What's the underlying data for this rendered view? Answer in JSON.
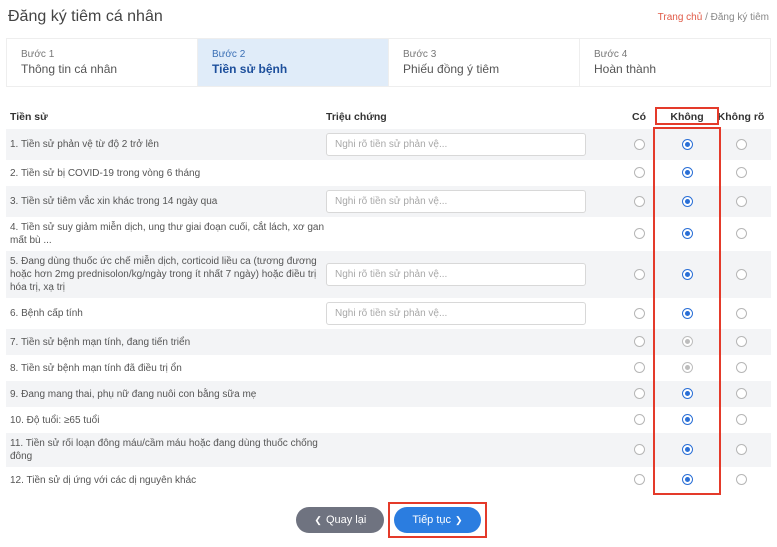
{
  "header": {
    "title": "Đăng ký tiêm cá nhân",
    "breadcrumb_home": "Trang chủ",
    "breadcrumb_sep": "/",
    "breadcrumb_current": "Đăng ký tiêm"
  },
  "steps": [
    {
      "num": "Bước 1",
      "label": "Thông tin cá nhân"
    },
    {
      "num": "Bước 2",
      "label": "Tiền sử bệnh"
    },
    {
      "num": "Bước 3",
      "label": "Phiếu đồng ý tiêm"
    },
    {
      "num": "Bước 4",
      "label": "Hoàn thành"
    }
  ],
  "active_step_index": 1,
  "columns": {
    "history": "Tiền sử",
    "symptom": "Triệu chứng",
    "yes": "Có",
    "no": "Không",
    "unknown": "Không rõ"
  },
  "symptom_placeholder": "Nghi rõ tiền sử phản vệ...",
  "rows": [
    {
      "label": "1. Tiền sử phản vệ từ độ 2 trở lên",
      "has_input": true,
      "selected": "no",
      "grey": false
    },
    {
      "label": "2. Tiền sử bị COVID-19 trong vòng 6 tháng",
      "has_input": false,
      "selected": "no",
      "grey": false
    },
    {
      "label": "3. Tiền sử tiêm vắc xin khác trong 14 ngày qua",
      "has_input": true,
      "selected": "no",
      "grey": false
    },
    {
      "label": "4. Tiền sử suy giảm miễn dịch, ung thư giai đoạn cuối, cắt lách, xơ gan mất bù ...",
      "has_input": false,
      "selected": "no",
      "grey": false
    },
    {
      "label": "5. Đang dùng thuốc ức chế miễn dịch, corticoid liều ca (tương đương hoặc hơn 2mg prednisolon/kg/ngày trong ít nhất 7 ngày) hoặc điều trị hóa trị, xạ trị",
      "has_input": true,
      "selected": "no",
      "grey": false
    },
    {
      "label": "6. Bệnh cấp tính",
      "has_input": true,
      "selected": "no",
      "grey": false
    },
    {
      "label": "7. Tiền sử bệnh mạn tính, đang tiến triển",
      "has_input": false,
      "selected": "no",
      "grey": true
    },
    {
      "label": "8. Tiền sử bệnh mạn tính đã điều trị ổn",
      "has_input": false,
      "selected": "no",
      "grey": true
    },
    {
      "label": "9. Đang mang thai, phụ nữ đang nuôi con bằng sữa mẹ",
      "has_input": false,
      "selected": "no",
      "grey": false
    },
    {
      "label": "10. Độ tuổi: ≥65 tuổi",
      "has_input": false,
      "selected": "no",
      "grey": false
    },
    {
      "label": "11. Tiền sử rối loạn đông máu/cầm máu hoặc đang dùng thuốc chống đông",
      "has_input": false,
      "selected": "no",
      "grey": false
    },
    {
      "label": "12. Tiền sử dị ứng với các dị nguyên khác",
      "has_input": false,
      "selected": "no",
      "grey": false
    }
  ],
  "buttons": {
    "back": "Quay lại",
    "next": "Tiếp tục"
  }
}
